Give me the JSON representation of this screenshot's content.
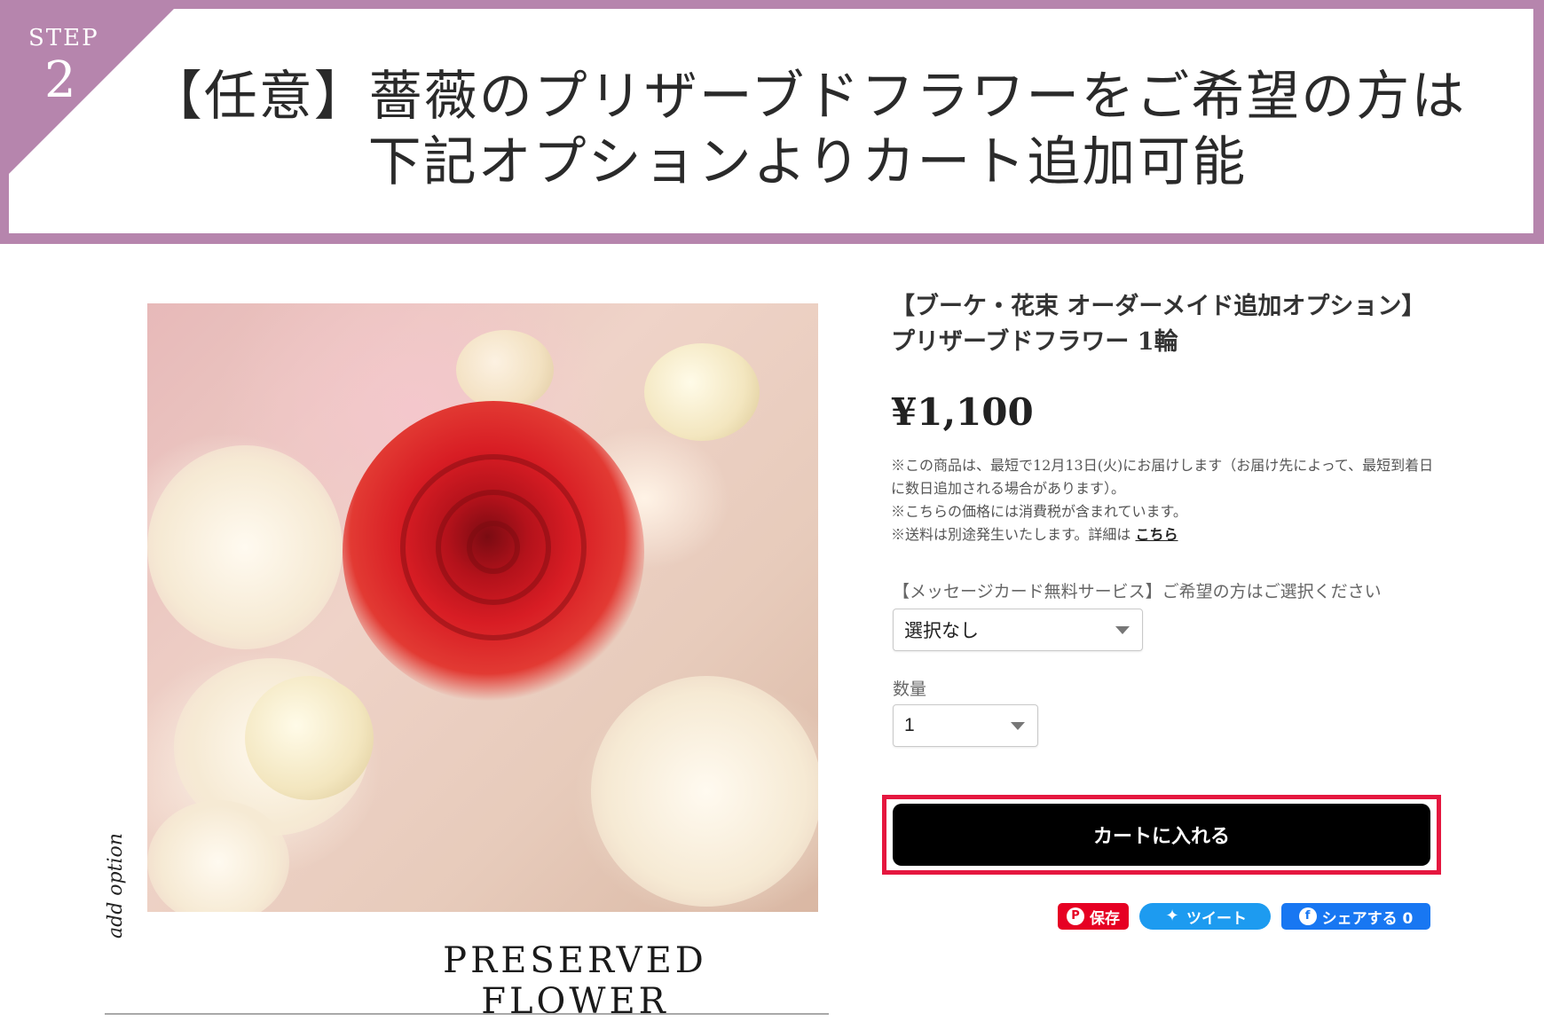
{
  "step": {
    "label": "STEP",
    "number": "2"
  },
  "headline": {
    "line1": "【任意】薔薇のプリザーブドフラワーをご希望の方は",
    "line2": "下記オプションよりカート追加可能"
  },
  "image": {
    "caption": "PRESERVED FLOWER",
    "side_text": "add option"
  },
  "product": {
    "title": "【ブーケ・花束 オーダーメイド追加オプション】プリザーブドフラワー 1輪",
    "price": "¥1,100",
    "notes": [
      "※この商品は、最短で12月13日(火)にお届けします（お届け先によって、最短到着日に数日追加される場合があります）。",
      "※こちらの価格には消費税が含まれています。",
      "※送料は別途発生いたします。詳細は"
    ],
    "notes_link": "こちら"
  },
  "message_card": {
    "label": "【メッセージカード無料サービス】ご希望の方はご選択ください",
    "selected": "選択なし"
  },
  "quantity": {
    "label": "数量",
    "selected": "1"
  },
  "cart": {
    "button_label": "カートに入れる",
    "highlight_color": "#e5173f"
  },
  "share": {
    "pinterest": "保存",
    "twitter": "ツイート",
    "facebook": "シェアする 0"
  },
  "colors": {
    "header_band": "#b685ad",
    "cart_button": "#000000"
  }
}
